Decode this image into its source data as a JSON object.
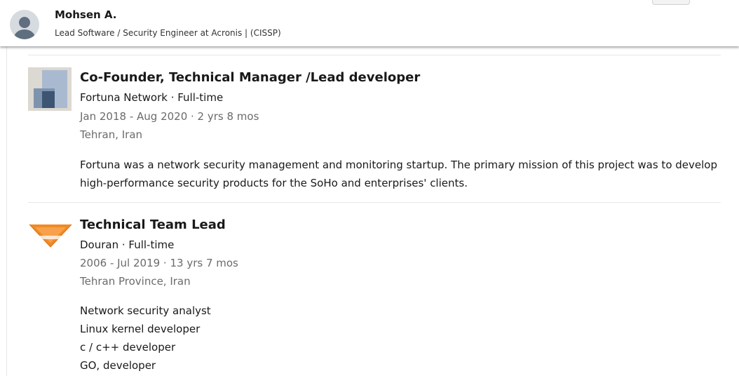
{
  "profile": {
    "name": "Mohsen A.",
    "headline": "Lead Software / Security Engineer at Acronis | (CISSP)"
  },
  "experience": [
    {
      "title": "Co-Founder, Technical Manager /Lead developer",
      "company": "Fortuna Network · Full-time",
      "dates": "Jan 2018 - Aug 2020 · 2 yrs 8 mos",
      "location": "Tehran, Iran",
      "description": "Fortuna was a network security management and monitoring startup. The primary mission of this project was to develop high-performance security products for the SoHo and enterprises' clients."
    },
    {
      "title": "Technical Team Lead",
      "company": "Douran · Full-time",
      "dates": "2006 - Jul 2019 · 13 yrs 7 mos",
      "location": "Tehran Province, Iran",
      "description_lines": [
        "Network security analyst",
        "Linux kernel developer",
        "c / c++ developer",
        "GO, developer"
      ]
    }
  ],
  "icons": {
    "avatar": "person-silhouette-icon",
    "fortuna_logo": "fortuna-network-logo",
    "douran_logo": "douran-logo"
  },
  "colors": {
    "primary_text": "#191919",
    "secondary_text": "#6b6b6b",
    "douran_orange": "#f08a24"
  }
}
